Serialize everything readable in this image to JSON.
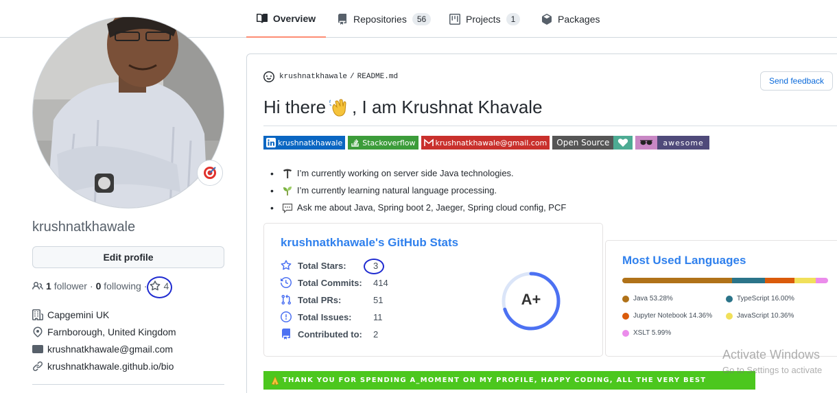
{
  "nav": {
    "tabs": [
      {
        "label": "Overview",
        "icon": "book-icon",
        "count": null
      },
      {
        "label": "Repositories",
        "icon": "repo-icon",
        "count": "56"
      },
      {
        "label": "Projects",
        "icon": "project-icon",
        "count": "1"
      },
      {
        "label": "Packages",
        "icon": "package-icon",
        "count": null
      }
    ],
    "active_tab": "Overview"
  },
  "profile": {
    "username": "krushnatkhawale",
    "edit_label": "Edit profile",
    "followers_count": "1",
    "followers_label": "follower",
    "separator": "·",
    "following_count": "0",
    "following_label": "following",
    "stars_count": "4",
    "company": "Capgemini UK",
    "location": "Farnborough, United Kingdom",
    "email": "krushnatkhawale@gmail.com",
    "website": "krushnatkhawale.github.io/bio"
  },
  "readme": {
    "owner": "krushnatkhawale",
    "separator": "/",
    "file": "README.md",
    "feedback_label": "Send feedback",
    "heading_pre": "Hi there",
    "heading_post": ", I am Krushnat Khavale",
    "badges": [
      {
        "left": "krushnatkhawale",
        "icon": "linkedin-icon",
        "color": "#0a66c2"
      },
      {
        "left": "Stackoverflow",
        "icon": "stackoverflow-icon",
        "color": "#3c9c3a"
      },
      {
        "left": "krushnatkhawale@gmail.com",
        "icon": "gmail-icon",
        "color": "#c9302c"
      },
      {
        "left": "Open Source",
        "icon": "heart-icon",
        "color": "#555555",
        "right_color": "#4dab93"
      },
      {
        "left": "awesome",
        "icon": "sunglasses-icon",
        "color": "#c887c4",
        "right_color": "#4f4a7a"
      }
    ],
    "bullets": [
      "I’m currently working on server side Java technologies.",
      "I’m currently learning natural language processing.",
      "Ask me about Java, Spring boot 2, Jaeger, Spring cloud config, PCF"
    ]
  },
  "stats": {
    "title": "krushnatkhawale's GitHub Stats",
    "rows": [
      {
        "label": "Total Stars:",
        "value": "3"
      },
      {
        "label": "Total Commits:",
        "value": "414"
      },
      {
        "label": "Total PRs:",
        "value": "51"
      },
      {
        "label": "Total Issues:",
        "value": "11"
      },
      {
        "label": "Contributed to:",
        "value": "2"
      }
    ],
    "grade": "A+",
    "grade_progress": 0.7,
    "accent": "#4c71f2",
    "title_color": "#2f80ed"
  },
  "languages": {
    "title": "Most Used Languages",
    "items": [
      {
        "name": "Java",
        "percent": 53.28,
        "label": "53.28%",
        "color": "#b07219"
      },
      {
        "name": "TypeScript",
        "percent": 16.0,
        "label": "16.00%",
        "color": "#2b7489"
      },
      {
        "name": "Jupyter Notebook",
        "percent": 14.36,
        "label": "14.36%",
        "color": "#da5b0b"
      },
      {
        "name": "JavaScript",
        "percent": 10.36,
        "label": "10.36%",
        "color": "#f1e05a"
      },
      {
        "name": "XSLT",
        "percent": 5.99,
        "label": "5.99%",
        "color": "#eb8ceb"
      }
    ]
  },
  "thanks_banner": "THANK YOU FOR SPENDING A_MOMENT ON MY PROFILE, HAPPY CODING, ALL THE VERY BEST",
  "watermark": {
    "line1": "Activate Windows",
    "line2": "Go to Settings to activate"
  }
}
